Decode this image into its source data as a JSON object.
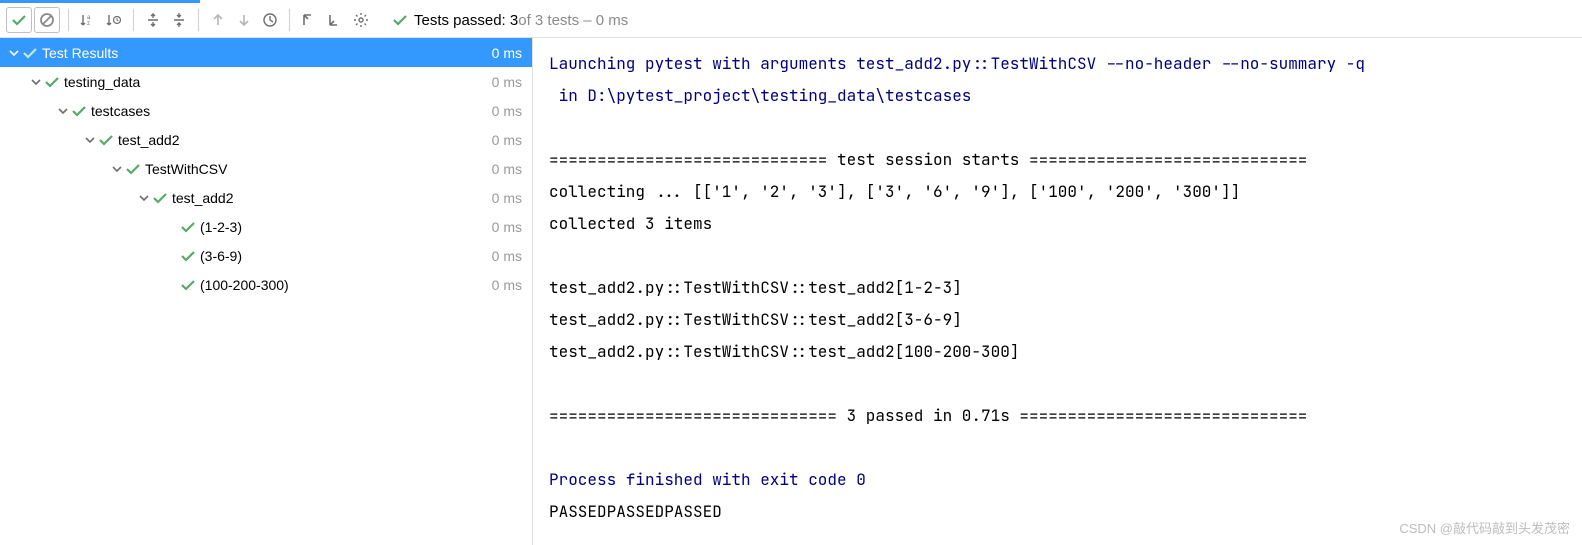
{
  "status": {
    "label": "Tests passed:",
    "count": "3",
    "rest": " of 3 tests – 0 ms"
  },
  "tree": {
    "header": {
      "label": "Test Results",
      "dur": "0 ms"
    },
    "n1": {
      "label": "testing_data",
      "dur": "0 ms"
    },
    "n2": {
      "label": "testcases",
      "dur": "0 ms"
    },
    "n3": {
      "label": "test_add2",
      "dur": "0 ms"
    },
    "n4": {
      "label": "TestWithCSV",
      "dur": "0 ms"
    },
    "n5": {
      "label": "test_add2",
      "dur": "0 ms"
    },
    "n6": {
      "label": "(1-2-3)",
      "dur": "0 ms"
    },
    "n7": {
      "label": "(3-6-9)",
      "dur": "0 ms"
    },
    "n8": {
      "label": "(100-200-300)",
      "dur": "0 ms"
    }
  },
  "console": {
    "l1": "Launching pytest with arguments test_add2.py::TestWithCSV --no-header --no-summary -q",
    "l2": " in D:\\pytest_project\\testing_data\\testcases",
    "l3": "",
    "l4": "============================= test session starts =============================",
    "l5": "collecting ... [['1', '2', '3'], ['3', '6', '9'], ['100', '200', '300']]",
    "l6": "collected 3 items",
    "l7": "",
    "l8": "test_add2.py::TestWithCSV::test_add2[1-2-3] ",
    "l9": "test_add2.py::TestWithCSV::test_add2[3-6-9] ",
    "l10": "test_add2.py::TestWithCSV::test_add2[100-200-300] ",
    "l11": "",
    "l12": "============================== 3 passed in 0.71s ==============================",
    "l13": "",
    "l14": "Process finished with exit code 0",
    "l15": "PASSEDPASSEDPASSED"
  },
  "watermark": "CSDN @敲代码敲到头发茂密"
}
